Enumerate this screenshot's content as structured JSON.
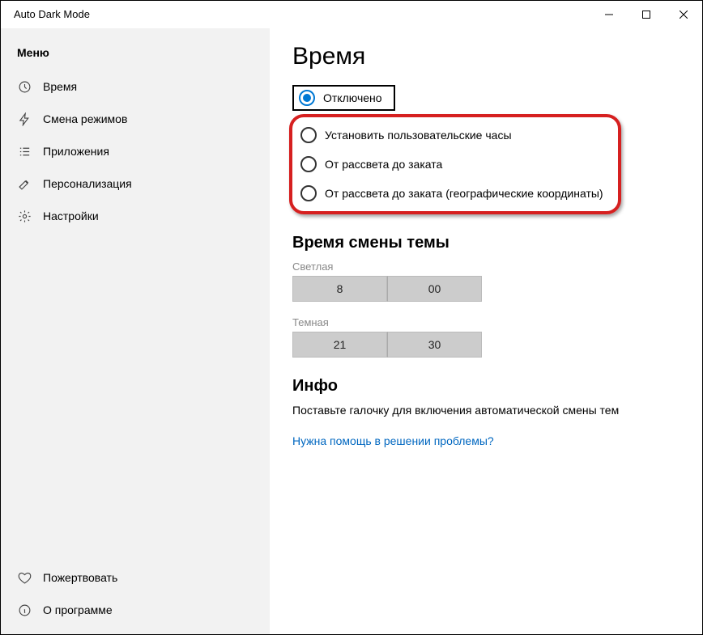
{
  "titlebar": {
    "title": "Auto Dark Mode"
  },
  "sidebar": {
    "heading": "Меню",
    "items": [
      {
        "label": "Время"
      },
      {
        "label": "Смена режимов"
      },
      {
        "label": "Приложения"
      },
      {
        "label": "Персонализация"
      },
      {
        "label": "Настройки"
      }
    ],
    "footer": [
      {
        "label": "Пожертвовать"
      },
      {
        "label": "О программе"
      }
    ]
  },
  "page": {
    "title": "Время",
    "radios": {
      "disabled": "Отключено",
      "custom": "Установить пользовательские часы",
      "sunrise": "От рассвета до заката",
      "geo": "От рассвета до заката (географические координаты)"
    },
    "theme_switch_title": "Время смены темы",
    "light_label": "Светлая",
    "light_hour": "8",
    "light_minute": "00",
    "dark_label": "Темная",
    "dark_hour": "21",
    "dark_minute": "30",
    "info_title": "Инфо",
    "info_text": "Поставьте галочку для включения автоматической смены тем",
    "help_link": "Нужна помощь в решении проблемы?"
  }
}
